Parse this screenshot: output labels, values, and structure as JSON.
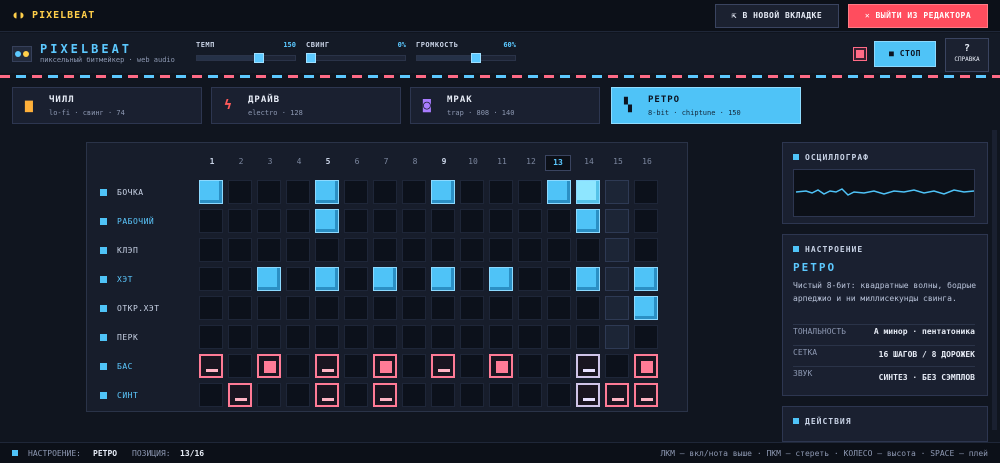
{
  "topbar": {
    "logo": "PIXELBEAT",
    "new_tab": "В НОВОЙ ВКЛАДКЕ",
    "exit": "ВЫЙТИ ИЗ РЕДАКТОРА"
  },
  "app": {
    "title": "PIXELBEAT",
    "subtitle": "пиксельный битмейкер · web audio",
    "tempo": {
      "label": "ТЕМП",
      "value": "150",
      "level": 0.63
    },
    "swing": {
      "label": "СВИНГ",
      "value": "0%",
      "level": 0.0
    },
    "volume": {
      "label": "ГРОМКОСТЬ",
      "value": "60%",
      "level": 0.6
    },
    "stop": "СТОП",
    "help_symbol": "?",
    "help": "СПРАВКА"
  },
  "moods": [
    {
      "name": "ЧИЛЛ",
      "meta": "lo-fi · свинг · 74",
      "icon": "coffee-cup-icon",
      "color": "#ffb03a"
    },
    {
      "name": "ДРАЙВ",
      "meta": "electro · 128",
      "icon": "lightning-icon",
      "color": "#ff5a5a"
    },
    {
      "name": "МРАК",
      "meta": "trap · 808 · 140",
      "icon": "skull-icon",
      "color": "#a97cff"
    },
    {
      "name": "РЕТРО",
      "meta": "8-bit · chiptune · 150",
      "icon": "space-invader-icon",
      "color": "#0c1320",
      "active": true
    }
  ],
  "sequencer": {
    "steps": [
      "1",
      "2",
      "3",
      "4",
      "5",
      "6",
      "7",
      "8",
      "9",
      "10",
      "11",
      "12",
      "13",
      "14",
      "15",
      "16"
    ],
    "current_step": 13,
    "tracks": [
      {
        "name": "БОЧКА",
        "type": "drum",
        "highlight": false,
        "on": [
          1,
          5,
          9,
          13,
          14
        ]
      },
      {
        "name": "РАБОЧИЙ",
        "type": "drum",
        "highlight": true,
        "on": [
          5,
          14
        ]
      },
      {
        "name": "КЛЭП",
        "type": "drum",
        "highlight": false,
        "on": []
      },
      {
        "name": "ХЭТ",
        "type": "drum",
        "highlight": true,
        "on": [
          3,
          5,
          7,
          9,
          11,
          14,
          16
        ]
      },
      {
        "name": "ОТКР.ХЭТ",
        "type": "drum",
        "highlight": false,
        "on": [
          16
        ]
      },
      {
        "name": "ПЕРК",
        "type": "drum",
        "highlight": false,
        "on": []
      },
      {
        "name": "БАС",
        "type": "melodic",
        "highlight": true,
        "notes": {
          "1": "low",
          "3": "high",
          "5": "low",
          "7": "high",
          "9": "low",
          "11": "high",
          "14": "low",
          "16": "high"
        }
      },
      {
        "name": "СИНТ",
        "type": "melodic",
        "highlight": true,
        "notes": {
          "2": "low",
          "5": "low",
          "7": "low",
          "14": "low",
          "15": "low",
          "16": "low"
        }
      }
    ]
  },
  "panels": {
    "oscilloscope": {
      "title": "ОСЦИЛЛОГРАФ"
    },
    "mood": {
      "title": "НАСТРОЕНИЕ",
      "name": "РЕТРО",
      "description": "Чистый 8-бит: квадратные волны, бодрые арпеджио и ни миллисекунды свинга.",
      "rows": [
        {
          "key": "ТОНАЛЬНОСТЬ",
          "value": "A минор · пентатоника"
        },
        {
          "key": "СЕТКА",
          "value": "16 ШАГОВ / 8 ДОРОЖЕК"
        },
        {
          "key": "ЗВУК",
          "value": "СИНТЕЗ · БЕЗ СЭМПЛОВ"
        }
      ]
    },
    "actions": {
      "title": "ДЕЙСТВИЯ"
    }
  },
  "status": {
    "mood_label": "НАСТРОЕНИЕ:",
    "mood_value": "РЕТРО",
    "pos_label": "ПОЗИЦИЯ:",
    "pos_value": "13/16",
    "hints": "ЛКМ — вкл/нота выше · ПКМ — стереть · КОЛЕСО — высота · SPACE — плей"
  },
  "colors": {
    "accent": "#4fc3f7",
    "pink": "#ff7b96",
    "exit": "#ff4d5e",
    "logo": "#ffcf4a"
  }
}
